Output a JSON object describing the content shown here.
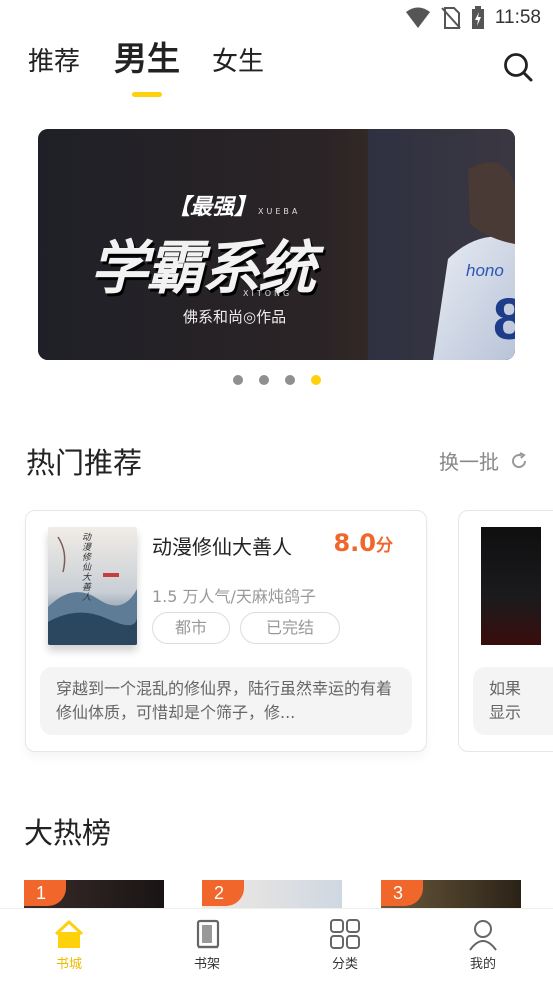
{
  "status_bar": {
    "time": "11:58",
    "icons": [
      "wifi-icon",
      "no-sim-icon",
      "battery-charging-icon"
    ]
  },
  "top_tabs": [
    {
      "label": "推荐",
      "active": false
    },
    {
      "label": "男生",
      "active": true
    },
    {
      "label": "女生",
      "active": false
    }
  ],
  "banner": {
    "tag": "【最强】",
    "title": "学霸系统",
    "subtitle_top": "XUEBA",
    "subtitle_bottom": "XITONG",
    "author_line": "佛系和尚◎作品",
    "jersey_text": "hono",
    "jersey_number": "8",
    "page_count": 4,
    "active_page": 4
  },
  "hot_section": {
    "title": "热门推荐",
    "refresh_label": "换一批",
    "books": [
      {
        "cover_text": "动漫修仙大善人",
        "name": "动漫修仙大善人",
        "score": "8.0",
        "score_unit": "分",
        "meta": "1.5 万人气/天麻炖鸽子",
        "tags": [
          "都市",
          "已完结"
        ],
        "synopsis": "穿越到一个混乱的修仙界，陆行虽然幸运的有着修仙体质，可惜却是个筛子，修..."
      },
      {
        "synopsis_line1": "如果",
        "synopsis_line2": "显示"
      }
    ]
  },
  "rank_section": {
    "title": "大热榜",
    "badges": [
      "1",
      "2",
      "3"
    ]
  },
  "bottom_nav": [
    {
      "label": "书城",
      "icon": "home-icon",
      "active": true
    },
    {
      "label": "书架",
      "icon": "bookshelf-icon",
      "active": false
    },
    {
      "label": "分类",
      "icon": "category-grid-icon",
      "active": false
    },
    {
      "label": "我的",
      "icon": "profile-icon",
      "active": false
    }
  ],
  "colors": {
    "accent": "#ffd10a",
    "score": "#f0662b",
    "nav_active": "#f2b800"
  }
}
